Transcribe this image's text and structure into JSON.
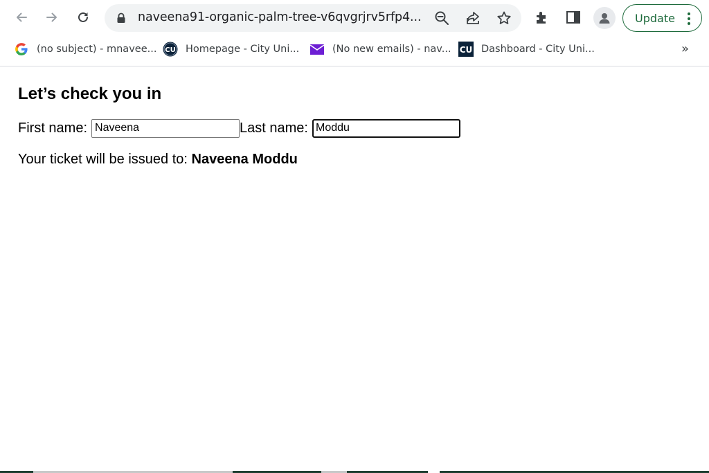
{
  "browser": {
    "url": "naveena91-organic-palm-tree-v6qvgrjrv5rfp4...",
    "update_label": "Update"
  },
  "bookmarks": [
    {
      "label": "(no subject) - mnavee...",
      "icon": "google-icon"
    },
    {
      "label": "Homepage - City Uni...",
      "icon": "cu-round-icon"
    },
    {
      "label": "(No new emails) - nav...",
      "icon": "mail-icon"
    },
    {
      "label": "Dashboard - City Uni...",
      "icon": "cu-square-icon"
    }
  ],
  "bookmarks_more": "»",
  "page": {
    "title": "Let’s check you in",
    "first_name_label": "First name:",
    "first_name_value": "Naveena",
    "last_name_label": "Last name:",
    "last_name_value": "Moddu",
    "ticket_prefix": "Your ticket will be issued to:",
    "ticket_name": "Naveena Moddu"
  },
  "colors": {
    "accent_green": "#1e6b3c",
    "omnibox_bg": "#f1f3f4",
    "mail_purple": "#6d1ed4",
    "cu_navy": "#0b2239"
  }
}
